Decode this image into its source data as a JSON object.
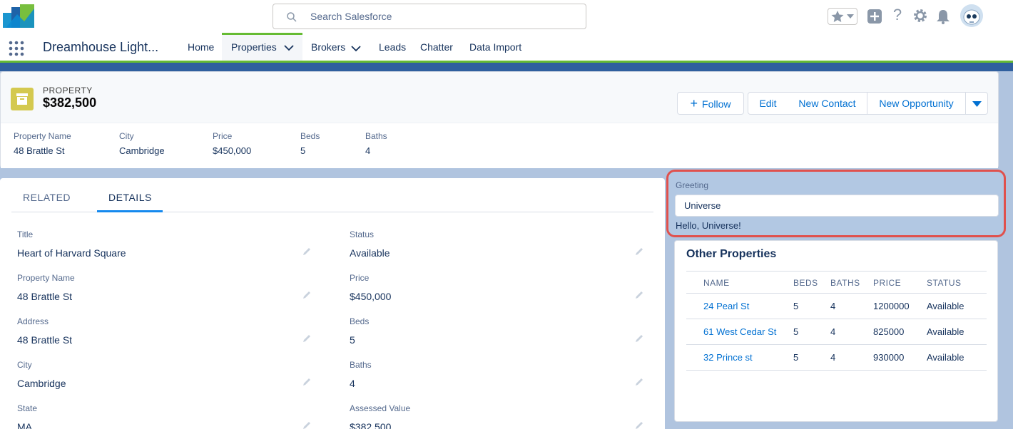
{
  "header": {
    "search_placeholder": "Search Salesforce"
  },
  "nav": {
    "app_name": "Dreamhouse Light...",
    "items": [
      {
        "label": "Home"
      },
      {
        "label": "Properties"
      },
      {
        "label": "Brokers"
      },
      {
        "label": "Leads"
      },
      {
        "label": "Chatter"
      },
      {
        "label": "Data Import"
      }
    ]
  },
  "record": {
    "object_label": "PROPERTY",
    "title": "$382,500",
    "actions": {
      "follow": "Follow",
      "edit": "Edit",
      "new_contact": "New Contact",
      "new_opportunity": "New Opportunity"
    },
    "highlights": [
      {
        "label": "Property Name",
        "value": "48 Brattle St"
      },
      {
        "label": "City",
        "value": "Cambridge"
      },
      {
        "label": "Price",
        "value": "$450,000"
      },
      {
        "label": "Beds",
        "value": "5"
      },
      {
        "label": "Baths",
        "value": "4"
      }
    ]
  },
  "tabs": {
    "related": "RELATED",
    "details": "DETAILS"
  },
  "details": {
    "left": [
      {
        "label": "Title",
        "value": "Heart of Harvard Square"
      },
      {
        "label": "Property Name",
        "value": "48 Brattle St"
      },
      {
        "label": "Address",
        "value": "48 Brattle St"
      },
      {
        "label": "City",
        "value": "Cambridge"
      },
      {
        "label": "State",
        "value": "MA"
      }
    ],
    "right": [
      {
        "label": "Status",
        "value": "Available"
      },
      {
        "label": "Price",
        "value": "$450,000"
      },
      {
        "label": "Beds",
        "value": "5"
      },
      {
        "label": "Baths",
        "value": "4"
      },
      {
        "label": "Assessed Value",
        "value": "$382,500"
      }
    ]
  },
  "greeting": {
    "label": "Greeting",
    "input_value": "Universe",
    "output": "Hello, Universe!"
  },
  "other_properties": {
    "title": "Other Properties",
    "columns": [
      "NAME",
      "BEDS",
      "BATHS",
      "PRICE",
      "STATUS"
    ],
    "rows": [
      {
        "name": "24 Pearl St",
        "beds": "5",
        "baths": "4",
        "price": "1200000",
        "status": "Available"
      },
      {
        "name": "61 West Cedar St",
        "beds": "5",
        "baths": "4",
        "price": "825000",
        "status": "Available"
      },
      {
        "name": "32 Prince st",
        "beds": "5",
        "baths": "4",
        "price": "930000",
        "status": "Available"
      }
    ]
  },
  "colors": {
    "accent_green": "#66bb33",
    "link_blue": "#0070d2",
    "property_icon": "#d4c94f",
    "highlight_border": "#e0514d"
  }
}
